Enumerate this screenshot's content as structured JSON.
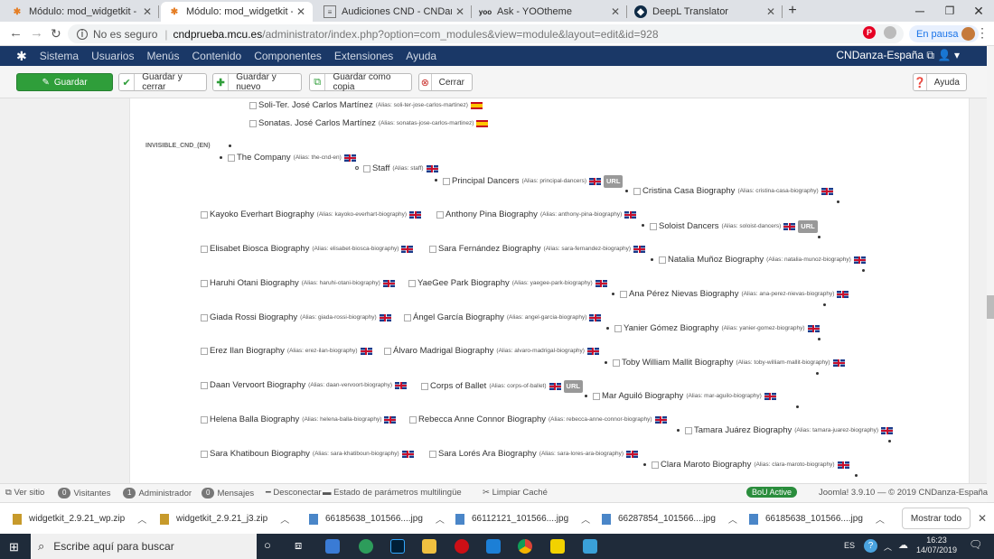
{
  "browser": {
    "tabs": [
      {
        "title": "Módulo: mod_widgetkit - CNDan",
        "icon": "joomla-icon"
      },
      {
        "title": "Módulo: mod_widgetkit - CNDan",
        "icon": "joomla-icon"
      },
      {
        "title": "Audiciones CND - CNDanza-Espa",
        "icon": "news-icon"
      },
      {
        "title": "Ask - YOOtheme",
        "icon": "yoo-icon"
      },
      {
        "title": "DeepL Translator",
        "icon": "deepl-icon"
      }
    ],
    "new_tab": "+",
    "url_security": "No es seguro",
    "url_domain": "cndprueba.mcu.es",
    "url_path": "/administrator/index.php?option=com_modules&view=module&layout=edit&id=928",
    "pause_label": "En pausa"
  },
  "jmenu": {
    "items": [
      "Sistema",
      "Usuarios",
      "Menús",
      "Contenido",
      "Componentes",
      "Extensiones",
      "Ayuda"
    ],
    "site": "CNDanza-España ⧉",
    "user": "👤 ▾"
  },
  "toolbar": {
    "save": "Guardar",
    "save_close": "Guardar y cerrar",
    "save_new": "Guardar y nuevo",
    "save_copy": "Guardar como copia",
    "close": "Cerrar",
    "help": "Ayuda"
  },
  "tree": {
    "section_label": "INVISIBLE_CND_(EN)",
    "top_items": [
      {
        "name": "Soli-Ter. José Carlos Martínez",
        "alias": "(Alias: soli-ter-jose-carlos-martinez)"
      },
      {
        "name": "Sonatas. José Carlos Martínez",
        "alias": "(Alias: sonatas-jose-carlos-martinez)"
      }
    ],
    "company": {
      "name": "The Company",
      "alias": "(Alias: the-cnd-en)"
    },
    "staff": {
      "name": "Staff",
      "alias": "(Alias: staff)"
    },
    "principal": {
      "name": "Principal Dancers",
      "alias": "(Alias: principal-dancers)"
    },
    "soloist": {
      "name": "Soloist Dancers",
      "alias": "(Alias: soloist-dancers)"
    },
    "corps": {
      "name": "Corps of Ballet",
      "alias": "(Alias: corps-of-ballet)"
    },
    "url_badge": "URL",
    "right_items": [
      {
        "name": "Cristina Casa Biography",
        "alias": "(Alias: cristina-casa-biography)"
      },
      {
        "name": "Natalia Muñoz Biography",
        "alias": "(Alias: natalia-munoz-biography)"
      },
      {
        "name": "Ana Pérez Nievas Biography",
        "alias": "(Alias: ana-perez-nievas-biography)"
      },
      {
        "name": "Yanier Gómez Biography",
        "alias": "(Alias: yanier-gomez-biography)"
      },
      {
        "name": "Toby William Mallit Biography",
        "alias": "(Alias: toby-william-mallit-biography)"
      },
      {
        "name": "Mar Aguiló Biography",
        "alias": "(Alias: mar-aguilo-biography)"
      },
      {
        "name": "Tamara Juárez Biography",
        "alias": "(Alias: tamara-juarez-biography)"
      },
      {
        "name": "Clara Maroto Biography",
        "alias": "(Alias: clara-maroto-biography)"
      }
    ],
    "left_items": [
      {
        "name": "Kayoko Everhart Biography",
        "alias": "(Alias: kayoko-everhart-biography)"
      },
      {
        "name": "Elisabet Biosca Biography",
        "alias": "(Alias: elisabet-biosca-biography)"
      },
      {
        "name": "Haruhi Otani Biography",
        "alias": "(Alias: haruhi-otani-biography)"
      },
      {
        "name": "Giada Rossi Biography",
        "alias": "(Alias: giada-rossi-biography)"
      },
      {
        "name": "Erez Ilan Biography",
        "alias": "(Alias: erez-ilan-biography)"
      },
      {
        "name": "Daan Vervoort Biography",
        "alias": "(Alias: daan-vervoort-biography)"
      },
      {
        "name": "Helena Balla Biography",
        "alias": "(Alias: helena-balla-biography)"
      },
      {
        "name": "Sara Khatiboun Biography",
        "alias": "(Alias: sara-khatiboun-biography)"
      }
    ],
    "mid_items": [
      {
        "name": "Anthony Pina Biography",
        "alias": "(Alias: anthony-pina-biography)"
      },
      {
        "name": "Sara Fernández Biography",
        "alias": "(Alias: sara-fernandez-biography)"
      },
      {
        "name": "YaeGee Park Biography",
        "alias": "(Alias: yaegee-park-biography)"
      },
      {
        "name": "Ángel García Biography",
        "alias": "(Alias: angel-garcia-biography)"
      },
      {
        "name": "Álvaro Madrigal Biography",
        "alias": "(Alias: alvaro-madrigal-biography)"
      },
      {
        "name": "Rebecca Anne Connor Biography",
        "alias": "(Alias: rebecca-anne-connor-biography)"
      },
      {
        "name": "Sara Lorés Ara Biography",
        "alias": "(Alias: sara-lores-ara-biography)"
      }
    ]
  },
  "status": {
    "view_site": "Ver sitio",
    "visitors_count": "0",
    "visitors": "Visitantes",
    "admin_count": "1",
    "admin": "Administrador",
    "msg_count": "0",
    "messages": "Mensajes",
    "logout": "Desconectar",
    "multilang": "Estado de parámetros multilingüe",
    "clear_cache": "Limpiar Caché",
    "bou": "BoU Active",
    "version": "Joomla! 3.9.10 — © 2019 CNDanza-España"
  },
  "downloads": {
    "files": [
      "widgetkit_2.9.21_wp.zip",
      "widgetkit_2.9.21_j3.zip",
      "66185638_101566....jpg",
      "66112121_101566....jpg",
      "66287854_101566....jpg",
      "66185638_101566....jpg"
    ],
    "show_all": "Mostrar todo"
  },
  "taskbar": {
    "search_placeholder": "Escribe aquí para buscar",
    "lang": "ES",
    "time": "16:23",
    "date": "14/07/2019"
  },
  "colors": {
    "joomla_nav": "#1a3867",
    "save_green": "#2f9e3a",
    "taskbar": "#1f2b3a"
  }
}
